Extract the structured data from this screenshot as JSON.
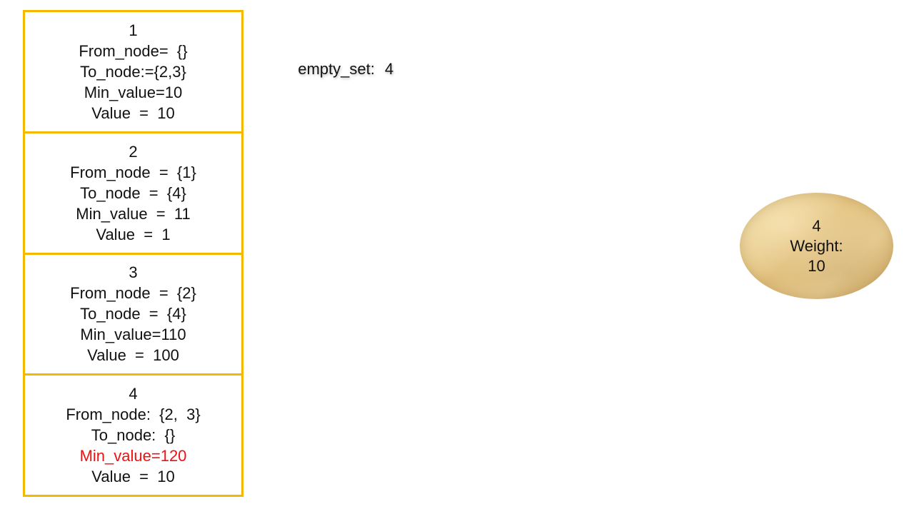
{
  "nodes": [
    {
      "id": "1",
      "from_node": "From_node=  {}",
      "to_node": "To_node:={2,3}",
      "min_value": "Min_value=10",
      "value": "Value  =  10"
    },
    {
      "id": "2",
      "from_node": "From_node  =  {1}",
      "to_node": "To_node  =  {4}",
      "min_value": "Min_value  =  11",
      "value": "Value  =  1"
    },
    {
      "id": "3",
      "from_node": "From_node  =  {2}",
      "to_node": "To_node  =  {4}",
      "min_value": "Min_value=110",
      "value": "Value  =  100"
    },
    {
      "id": "4",
      "from_node": "From_node:  {2,  3}",
      "to_node": "To_node:  {}",
      "min_value": "Min_value=120",
      "value": "Value  =  10"
    }
  ],
  "empty_set": {
    "label": "empty_set:",
    "value": "4"
  },
  "current_node": {
    "id": "4",
    "weight_label": "Weight:",
    "weight_value": "10"
  },
  "colors": {
    "box_border": "#f5b800",
    "highlight": "#ee1111",
    "ellipse_fill": "#e3c27f"
  }
}
